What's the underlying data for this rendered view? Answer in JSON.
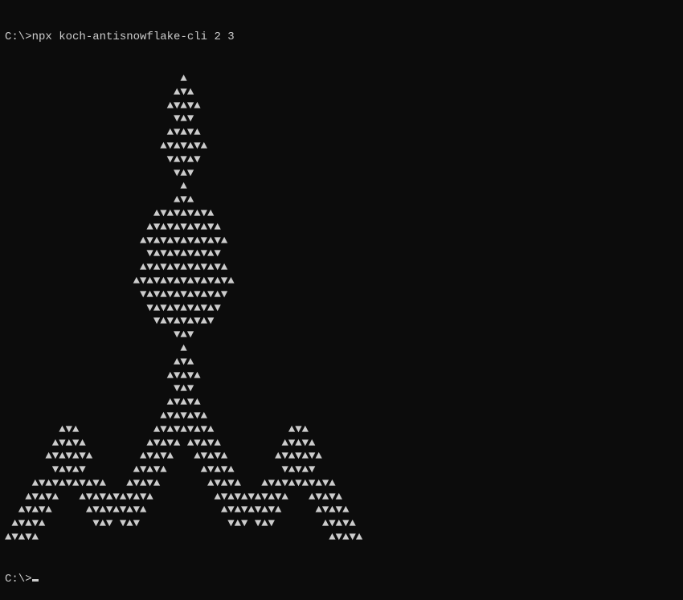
{
  "prompt1": {
    "prefix": "C:\\>",
    "command": "npx koch-antisnowflake-cli 2 3"
  },
  "output_lines": [
    "                          ▲",
    "                         ▲▼▲",
    "                        ▲▼▲▼▲",
    "                         ▼▲▼",
    "                        ▲▼▲▼▲",
    "                       ▲▼▲▼▲▼▲",
    "                        ▼▲▼▲▼",
    "                         ▼▲▼",
    "                          ▲",
    "                         ▲▼▲",
    "                      ▲▼▲▼▲▼▲▼▲",
    "                     ▲▼▲▼▲▼▲▼▲▼▲",
    "                    ▲▼▲▼▲▼▲▼▲▼▲▼▲",
    "                     ▼▲▼▲▼▲▼▲▼▲▼",
    "                    ▲▼▲▼▲▼▲▼▲▼▲▼▲",
    "                   ▲▼▲▼▲▼▲▼▲▼▲▼▲▼▲",
    "                    ▼▲▼▲▼▲▼▲▼▲▼▲▼",
    "                     ▼▲▼▲▼▲▼▲▼▲▼",
    "                      ▼▲▼▲▼▲▼▲▼",
    "                         ▼▲▼",
    "                          ▲",
    "                         ▲▼▲",
    "                        ▲▼▲▼▲",
    "                         ▼▲▼",
    "                        ▲▼▲▼▲",
    "                       ▲▼▲▼▲▼▲",
    "        ▲▼▲           ▲▼▲▼▲▼▲▼▲           ▲▼▲",
    "       ▲▼▲▼▲         ▲▼▲▼▲ ▲▼▲▼▲         ▲▼▲▼▲",
    "      ▲▼▲▼▲▼▲       ▲▼▲▼▲   ▲▼▲▼▲       ▲▼▲▼▲▼▲",
    "       ▼▲▼▲▼       ▲▼▲▼▲     ▲▼▲▼▲       ▼▲▼▲▼",
    "    ▲▼▲▼▲▼▲▼▲▼▲   ▲▼▲▼▲       ▲▼▲▼▲   ▲▼▲▼▲▼▲▼▲▼▲",
    "   ▲▼▲▼▲   ▲▼▲▼▲▼▲▼▲▼▲         ▲▼▲▼▲▼▲▼▲▼▲   ▲▼▲▼▲",
    "  ▲▼▲▼▲     ▲▼▲▼▲▼▲▼▲           ▲▼▲▼▲▼▲▼▲     ▲▼▲▼▲",
    " ▲▼▲▼▲       ▼▲▼ ▼▲▼             ▼▲▼ ▼▲▼       ▲▼▲▼▲",
    "▲▼▲▼▲                                           ▲▼▲▼▲"
  ],
  "prompt2": {
    "prefix": "C:\\>",
    "command": ""
  }
}
